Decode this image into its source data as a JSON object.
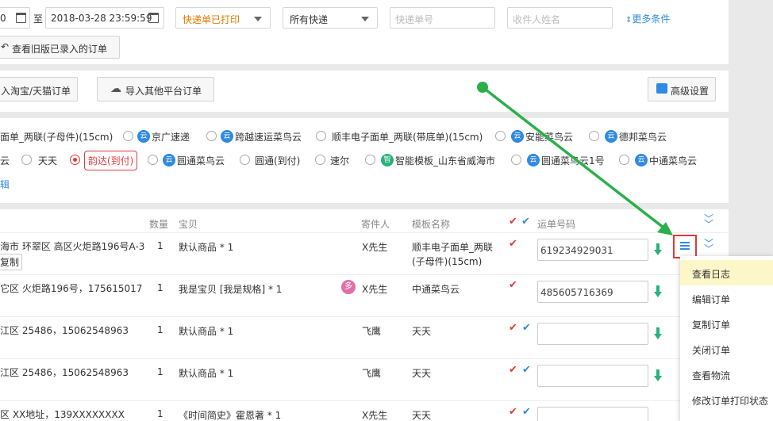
{
  "filters": {
    "start_date_value": "0",
    "range_separator": "至",
    "end_date_value": "2018-03-28 23:59:59",
    "status_select": "快递单已打印",
    "express_select": "所有快递",
    "tracking_placeholder": "快递单号",
    "receiver_placeholder": "收件人姓名",
    "more_conditions": "更多条件",
    "old_orders_button": "查看旧版已录入的订单"
  },
  "toolbar": {
    "import_taobao": "入淘宝/天猫订单",
    "import_other": "导入其他平台订单",
    "advanced_settings": "高级设置"
  },
  "templates": {
    "row1": [
      {
        "label": "面单_两联(子母件)(15cm)",
        "radio": false,
        "cloud": false
      },
      {
        "label": "京广速递",
        "radio": true,
        "cloud": true,
        "checked": false
      },
      {
        "label": "跨越速运菜鸟云",
        "radio": true,
        "cloud": true,
        "checked": false
      },
      {
        "label": "顺丰电子面单_两联(带底单)(15cm)",
        "radio": true,
        "cloud": false,
        "checked": false
      },
      {
        "label": "安能菜鸟云",
        "radio": true,
        "cloud": true,
        "checked": false
      },
      {
        "label": "德邦菜鸟云",
        "radio": true,
        "cloud": true,
        "checked": false
      }
    ],
    "row2": [
      {
        "label": "云",
        "radio": false,
        "cloud": false
      },
      {
        "label": "天天",
        "radio": true,
        "cloud": false,
        "checked": false
      },
      {
        "label": "韵达(到付)",
        "radio": true,
        "cloud": false,
        "checked": true
      },
      {
        "label": "圆通菜鸟云",
        "radio": true,
        "cloud": true,
        "checked": false
      },
      {
        "label": "圆通(到付)",
        "radio": true,
        "cloud": false,
        "checked": false
      },
      {
        "label": "速尔",
        "radio": true,
        "cloud": false,
        "checked": false
      },
      {
        "label": "智能模板_山东省威海市",
        "radio": true,
        "cloud": true,
        "green": true,
        "checked": false
      },
      {
        "label": "圆通菜鸟云1号",
        "radio": true,
        "cloud": true,
        "checked": false
      },
      {
        "label": "中通菜鸟云",
        "radio": true,
        "cloud": true,
        "checked": false
      }
    ],
    "edit_link": "辑",
    "cloud_glyph": "云",
    "smart_glyph": "智"
  },
  "table": {
    "headers": {
      "qty": "数量",
      "item": "宝贝",
      "sender": "寄件人",
      "template": "模板名称",
      "tracking": "运单号码"
    },
    "rows": [
      {
        "address": "海市 环翠区 高区火炬路196号A-3",
        "copy": "复制",
        "qty": "1",
        "item": "默认商品 * 1",
        "sender": "X先生",
        "template_line1": "顺丰电子面单_两联",
        "template_line2": "(子母件)(15cm)",
        "tracking": "619234929031",
        "checks": "red"
      },
      {
        "address": "它区 火炬路196号，175615017",
        "qty": "1",
        "item": "我是宝贝 [我是规格] * 1",
        "badge": "多",
        "sender": "X先生",
        "template_line1": "中通菜鸟云",
        "tracking": "485605716369",
        "checks": "red"
      },
      {
        "address": "江区 25486，15062548963",
        "qty": "1",
        "item": "默认商品 * 1",
        "sender": "飞鹰",
        "template_line1": "天天",
        "tracking": "",
        "checks": "both"
      },
      {
        "address": "江区 25486，15062548963",
        "qty": "1",
        "item": "默认商品 * 1",
        "sender": "飞鹰",
        "template_line1": "天天",
        "tracking": "",
        "checks": "both"
      },
      {
        "address": "区 XX地址，139XXXXXXXX",
        "qty": "1",
        "item": "《时间简史》霍恩著 * 1",
        "sender": "X先生",
        "template_line1": "天天",
        "tracking": "",
        "checks": "both"
      }
    ]
  },
  "context_menu": {
    "items": [
      "查看日志",
      "编辑订单",
      "复制订单",
      "关闭订单",
      "查看物流",
      "修改订单打印状态"
    ]
  },
  "colors": {
    "accent_blue": "#2f8ae3",
    "accent_red": "#e4393c",
    "accent_green": "#2ab27b",
    "status_orange": "#e07b00"
  }
}
